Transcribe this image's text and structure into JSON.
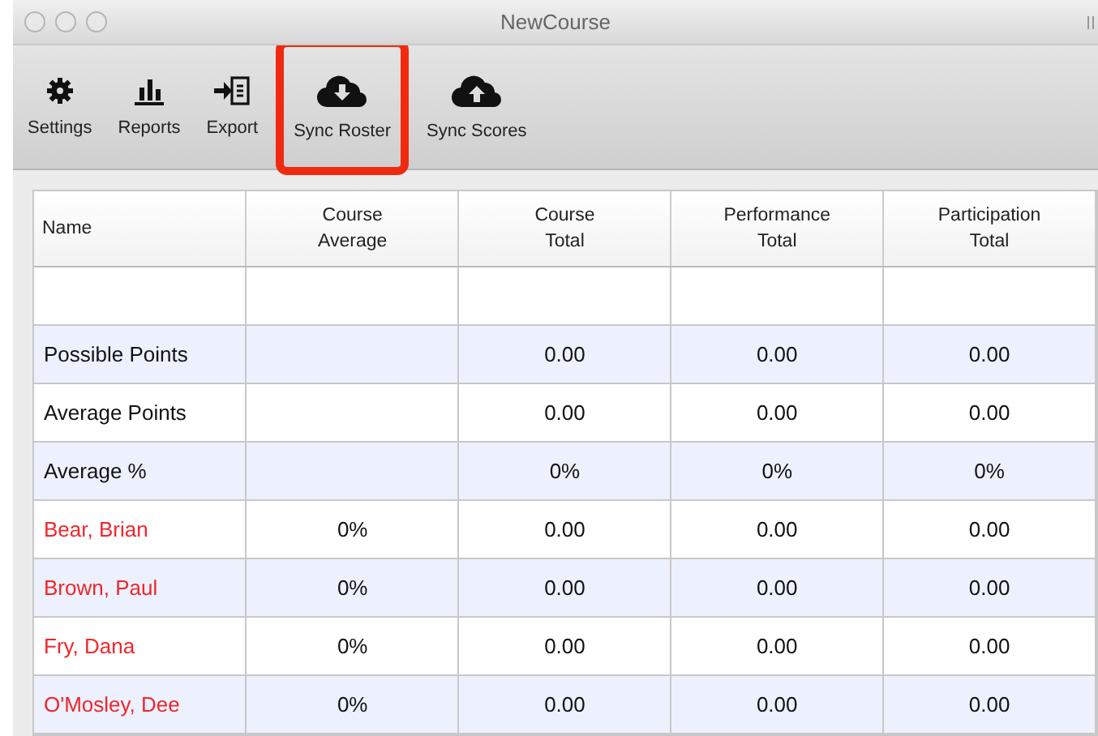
{
  "window": {
    "title": "NewCourse"
  },
  "toolbar": [
    {
      "label": "Settings",
      "highlighted": false
    },
    {
      "label": "Reports",
      "highlighted": false
    },
    {
      "label": "Export",
      "highlighted": false
    },
    {
      "label": "Sync Roster",
      "highlighted": true
    },
    {
      "label": "Sync Scores",
      "highlighted": false
    }
  ],
  "table": {
    "columns": [
      "Name",
      "Course\nAverage",
      "Course\nTotal",
      "Performance\nTotal",
      "Participation\nTotal"
    ],
    "rows": [
      {
        "kind": "blank"
      },
      {
        "kind": "summary",
        "name": "Possible Points",
        "totals": [
          "0.00",
          "0.00",
          "0.00"
        ]
      },
      {
        "kind": "summary",
        "name": "Average Points",
        "totals": [
          "0.00",
          "0.00",
          "0.00"
        ]
      },
      {
        "kind": "summary",
        "name": "Average %",
        "totals": [
          "0%",
          "0%",
          "0%"
        ]
      },
      {
        "kind": "student",
        "name": "Bear, Brian",
        "course_average": "0%",
        "totals": [
          "0.00",
          "0.00",
          "0.00"
        ]
      },
      {
        "kind": "student",
        "name": "Brown, Paul",
        "course_average": "0%",
        "totals": [
          "0.00",
          "0.00",
          "0.00"
        ]
      },
      {
        "kind": "student",
        "name": "Fry, Dana",
        "course_average": "0%",
        "totals": [
          "0.00",
          "0.00",
          "0.00"
        ]
      },
      {
        "kind": "student",
        "name": "O'Mosley, Dee",
        "course_average": "0%",
        "totals": [
          "0.00",
          "0.00",
          "0.00"
        ]
      }
    ]
  }
}
